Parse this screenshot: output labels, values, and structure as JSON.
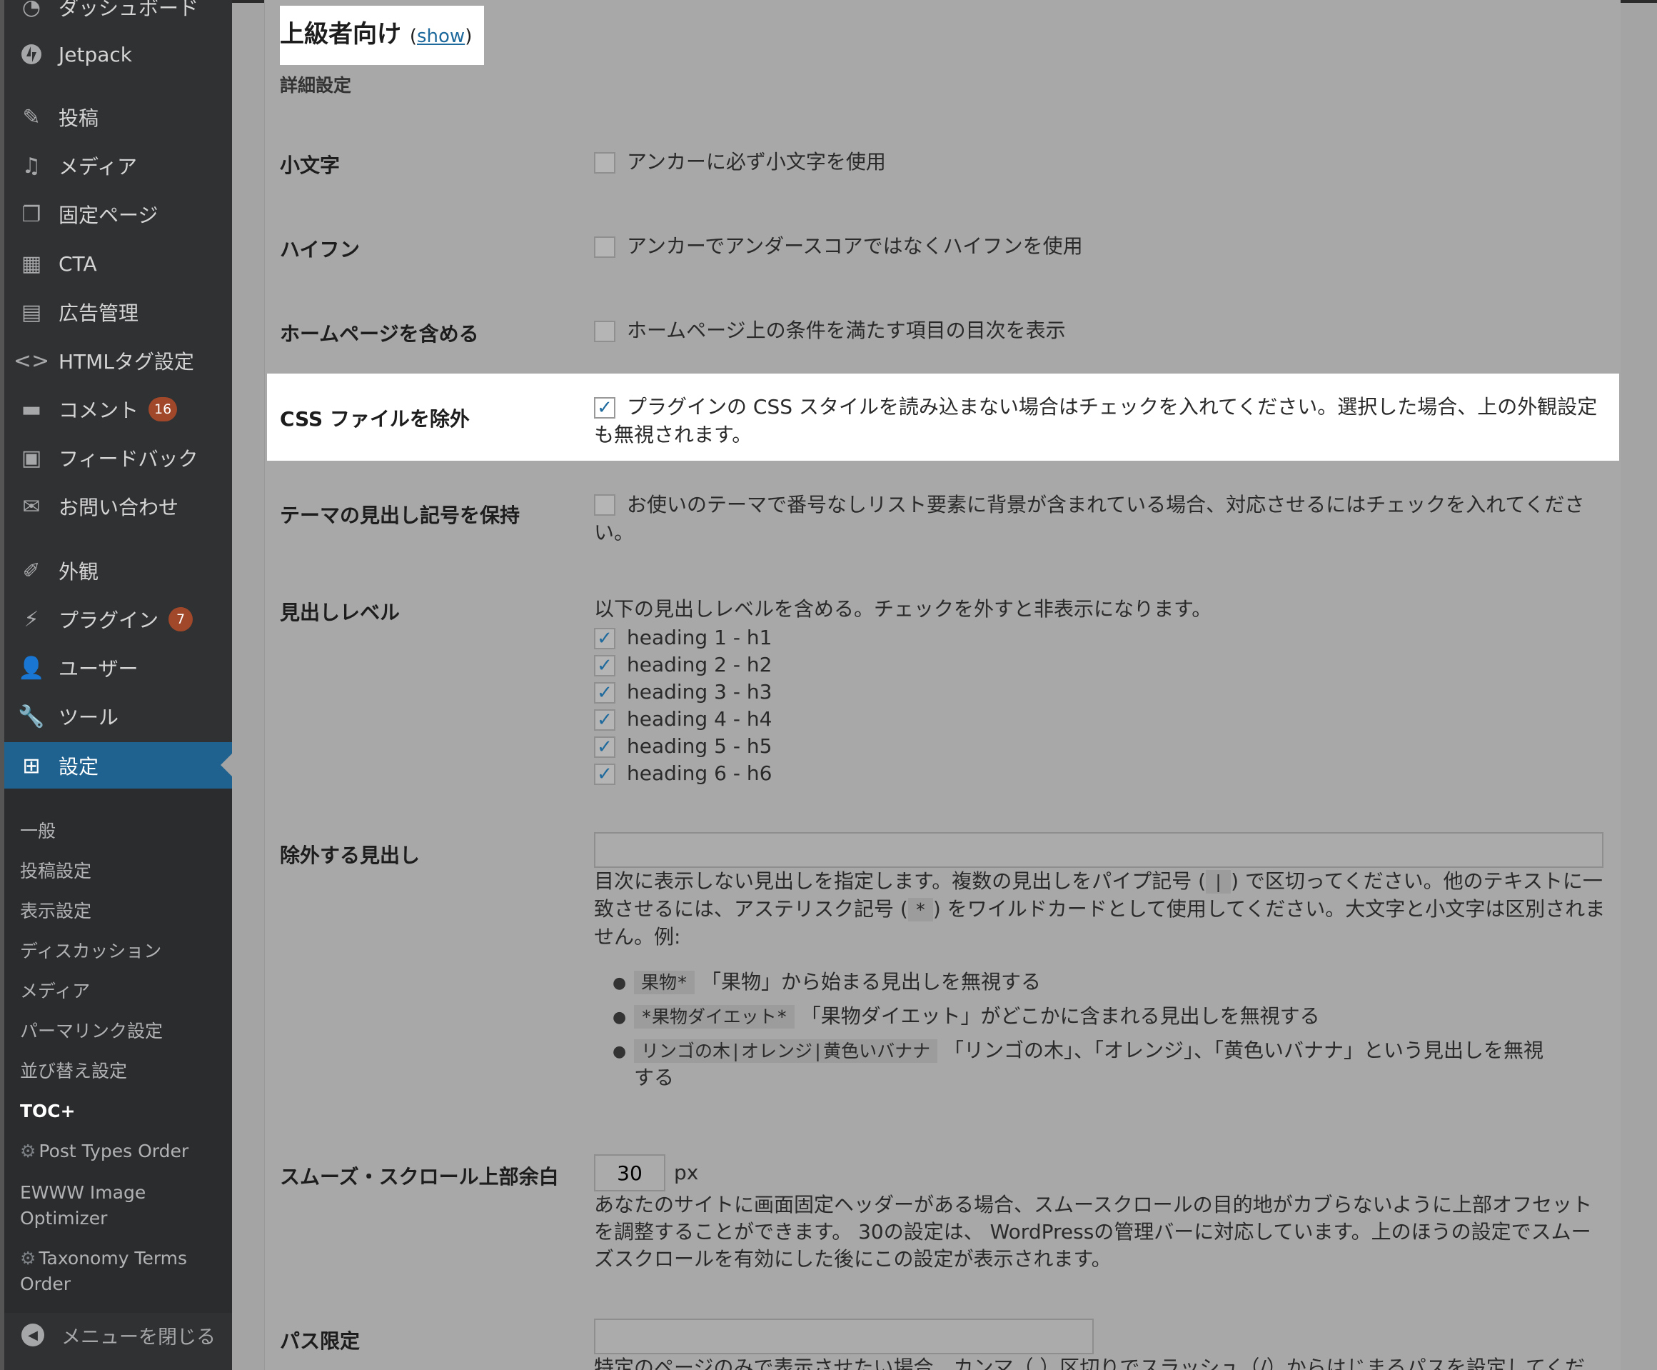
{
  "sidebar": {
    "items": [
      {
        "label": "ダッシュボード",
        "icon": "dashboard-icon"
      },
      {
        "label": "Jetpack",
        "icon": "jetpack-icon"
      },
      {
        "label": "投稿",
        "icon": "posts-icon"
      },
      {
        "label": "メディア",
        "icon": "media-icon"
      },
      {
        "label": "固定ページ",
        "icon": "pages-icon"
      },
      {
        "label": "CTA",
        "icon": "cta-icon"
      },
      {
        "label": "広告管理",
        "icon": "ads-icon"
      },
      {
        "label": "HTMLタグ設定",
        "icon": "code-icon"
      },
      {
        "label": "コメント",
        "icon": "comments-icon",
        "badge": "16"
      },
      {
        "label": "フィードバック",
        "icon": "feedback-icon"
      },
      {
        "label": "お問い合わせ",
        "icon": "mail-icon"
      },
      {
        "label": "外観",
        "icon": "appearance-icon"
      },
      {
        "label": "プラグイン",
        "icon": "plugins-icon",
        "badge": "7"
      },
      {
        "label": "ユーザー",
        "icon": "users-icon"
      },
      {
        "label": "ツール",
        "icon": "tools-icon"
      },
      {
        "label": "設定",
        "icon": "settings-icon"
      }
    ],
    "submenu": [
      "一般",
      "投稿設定",
      "表示設定",
      "ディスカッション",
      "メディア",
      "パーマリンク設定",
      "並び替え設定",
      "TOC+",
      "Post Types Order",
      "EWWW Image",
      "Optimizer",
      "Taxonomy Terms",
      "Order"
    ],
    "collapse": "メニューを閉じる"
  },
  "section": {
    "title": "上級者向け",
    "show_open": "(",
    "show_link": "show",
    "show_close": ")",
    "subtitle": "詳細設定"
  },
  "rows": {
    "lowercase": {
      "label": "小文字",
      "text": "アンカーに必ず小文字を使用",
      "checked": false
    },
    "hyphen": {
      "label": "ハイフン",
      "text": "アンカーでアンダースコアではなくハイフンを使用",
      "checked": false
    },
    "homepage": {
      "label": "ホームページを含める",
      "text": "ホームページ上の条件を満たす項目の目次を表示",
      "checked": false
    },
    "css": {
      "label": "CSS ファイルを除外",
      "text1": "プラグインの CSS スタイルを読み込まない場合はチェックを入れてください。選択した場合、上の外観設定",
      "text2": "も無視されます。",
      "checked": true
    },
    "theme_bullets": {
      "label": "テーマの見出し記号を保持",
      "text1": "お使いのテーマで番号なしリスト要素に背景が含まれている場合、対応させるにはチェックを入れてくださ",
      "text2": "い。",
      "checked": false
    },
    "heading_levels": {
      "label": "見出しレベル",
      "intro": "以下の見出しレベルを含める。チェックを外すと非表示になります。",
      "levels": [
        "heading 1 - h1",
        "heading 2 - h2",
        "heading 3 - h3",
        "heading 4 - h4",
        "heading 5 - h5",
        "heading 6 - h6"
      ]
    },
    "exclude": {
      "label": "除外する見出し",
      "value": "",
      "desc1": "目次に表示しない見出しを指定します。複数の見出しをパイプ記号 (",
      "pipe": "|",
      "desc1b": ") で区切ってください。他のテキストに一",
      "desc2a": "致させるには、アステリスク記号 (",
      "star": "*",
      "desc2b": ") をワイルドカードとして使用してください。大文字と小文字は区別されま",
      "desc3": "せん。例:",
      "examples": [
        {
          "code": "果物*",
          "text": "「果物」から始まる見出しを無視する"
        },
        {
          "code": "*果物ダイエット*",
          "text": "「果物ダイエット」がどこかに含まれる見出しを無視する"
        },
        {
          "code": "リンゴの木|オレンジ|黄色いバナナ",
          "text": "「リンゴの木」、「オレンジ」、「黄色いバナナ」という見出しを無視",
          "text2": "する"
        }
      ]
    },
    "smooth": {
      "label": "スムーズ・スクロール上部余白",
      "value": "30",
      "unit": "px",
      "desc1": "あなたのサイトに画面固定ヘッダーがある場合、スムースクロールの目的地がカブらないように上部オフセット",
      "desc2": "を調整することができます。 30の設定は、 WordPressの管理バーに対応しています。上のほうの設定でスムー",
      "desc3": "ズスクロールを有効にした後にこの設定が表示されます。"
    },
    "path": {
      "label": "パス限定",
      "value": "",
      "desc": "特定のページのみで表示させたい場合、カンマ（,）区切りでスラッシュ（/）からはじまるパスを設定してくだ"
    }
  }
}
